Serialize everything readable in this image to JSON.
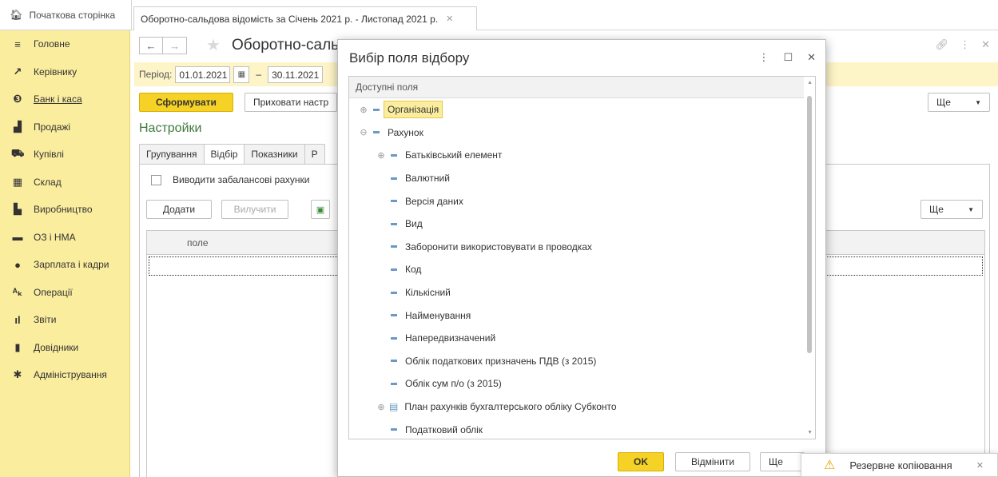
{
  "tabs": {
    "home": "Початкова сторінка",
    "report": "Оборотно-сальдова відомість за Січень 2021 р. - Листопад 2021 р."
  },
  "sidebar": {
    "items": [
      {
        "label": "Головне",
        "icon": "menu-icon"
      },
      {
        "label": "Керівнику",
        "icon": "trend-icon"
      },
      {
        "label": "Банк і каса",
        "icon": "bank-icon"
      },
      {
        "label": "Продажі",
        "icon": "bag-icon"
      },
      {
        "label": "Купівлі",
        "icon": "cart-icon"
      },
      {
        "label": "Склад",
        "icon": "warehouse-icon"
      },
      {
        "label": "Виробництво",
        "icon": "factory-icon"
      },
      {
        "label": "ОЗ і НМА",
        "icon": "truck-icon"
      },
      {
        "label": "Зарплата і кадри",
        "icon": "person-icon"
      },
      {
        "label": "Операції",
        "icon": "operations-icon"
      },
      {
        "label": "Звіти",
        "icon": "bar-chart-icon"
      },
      {
        "label": "Довідники",
        "icon": "book-icon"
      },
      {
        "label": "Адміністрування",
        "icon": "gear-icon"
      }
    ]
  },
  "form": {
    "title": "Оборотно-сальд",
    "period_label": "Період:",
    "date_from": "01.01.2021",
    "dash": "–",
    "date_to": "30.11.2021",
    "generate": "Сформувати",
    "hide_settings": "Приховати настр",
    "more": "Ще",
    "settings_title": "Настройки",
    "tabs": [
      "Групування",
      "Відбір",
      "Показники",
      "Р"
    ],
    "checkbox_label": "Виводити забалансові рахунки",
    "add": "Додати",
    "remove": "Вилучити",
    "column_field": "поле"
  },
  "dialog": {
    "title": "Вибір поля відбору",
    "list_header": "Доступні поля",
    "items": [
      {
        "label": "Організація",
        "level": 0,
        "expander": "⊕",
        "selected": true
      },
      {
        "label": "Рахунок",
        "level": 0,
        "expander": "⊖"
      },
      {
        "label": "Батьківський елемент",
        "level": 1,
        "expander": "⊕"
      },
      {
        "label": "Валютний",
        "level": 1
      },
      {
        "label": "Версія даних",
        "level": 1
      },
      {
        "label": "Вид",
        "level": 1
      },
      {
        "label": "Заборонити використовувати в проводках",
        "level": 1
      },
      {
        "label": "Код",
        "level": 1
      },
      {
        "label": "Кількісний",
        "level": 1
      },
      {
        "label": "Найменування",
        "level": 1
      },
      {
        "label": "Напередвизначений",
        "level": 1
      },
      {
        "label": "Облік податкових призначень ПДВ (з 2015)",
        "level": 1
      },
      {
        "label": "Облік сум п/о (з 2015)",
        "level": 1
      },
      {
        "label": "План рахунків бухгалтерського обліку Субконто",
        "level": 1,
        "expander": "⊕",
        "table": true
      },
      {
        "label": "Податковий облік",
        "level": 1
      }
    ],
    "ok": "OK",
    "cancel": "Відмінити",
    "more": "Ще"
  },
  "notification": {
    "text": "Резервне копіювання"
  },
  "colors": {
    "sidebar_bg": "#fbed9e",
    "accent_button": "#f5d225",
    "period_bar": "#fdf4c7",
    "settings_title": "#3c7a3c"
  }
}
